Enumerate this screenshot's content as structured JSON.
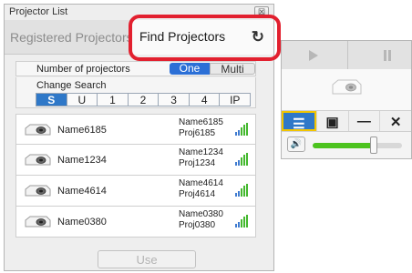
{
  "window": {
    "title": "Projector List",
    "close_label": "☒"
  },
  "tabs": {
    "registered": "Registered Projectors",
    "find": "Find Projectors",
    "refresh_icon": "↻"
  },
  "number_of_projectors": {
    "label": "Number of projectors",
    "one": "One",
    "multi": "Multi",
    "selected": "One"
  },
  "change_search": {
    "label": "Change Search",
    "keys": [
      "S",
      "U",
      "1",
      "2",
      "3",
      "4",
      "IP"
    ],
    "selected": "S"
  },
  "projectors": [
    {
      "name": "Name6185",
      "info_name": "Name6185",
      "info_id": "Proj6185"
    },
    {
      "name": "Name1234",
      "info_name": "Name1234",
      "info_id": "Proj1234"
    },
    {
      "name": "Name4614",
      "info_name": "Name4614",
      "info_id": "Proj4614"
    },
    {
      "name": "Name0380",
      "info_name": "Name0380",
      "info_id": "Proj0380"
    }
  ],
  "use_button": "Use",
  "control_panel": {
    "play_icon": "play-icon",
    "pause_icon": "pause-icon",
    "buttons": [
      {
        "icon": "list-icon",
        "glyph": "☰"
      },
      {
        "icon": "briefcase-icon",
        "glyph": "▣"
      },
      {
        "icon": "minimize-icon",
        "glyph": "—"
      },
      {
        "icon": "close-icon",
        "glyph": "✕"
      }
    ],
    "volume_icon": "speaker-icon",
    "volume_glyph": "🔊",
    "volume_level": 0.68
  },
  "colors": {
    "accent": "#2f78c8",
    "highlight": "#e2202f",
    "volume": "#4cc31e",
    "selected_border": "#f2c500"
  }
}
